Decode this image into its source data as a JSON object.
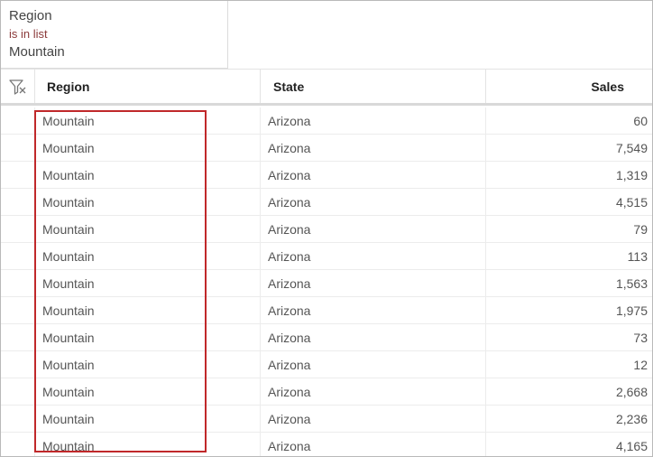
{
  "filter": {
    "field": "Region",
    "operator": "is in list",
    "value": "Mountain"
  },
  "table": {
    "columns": [
      "Region",
      "State",
      "Sales"
    ],
    "rows": [
      [
        "Mountain",
        "Arizona",
        "60"
      ],
      [
        "Mountain",
        "Arizona",
        "7,549"
      ],
      [
        "Mountain",
        "Arizona",
        "1,319"
      ],
      [
        "Mountain",
        "Arizona",
        "4,515"
      ],
      [
        "Mountain",
        "Arizona",
        "79"
      ],
      [
        "Mountain",
        "Arizona",
        "113"
      ],
      [
        "Mountain",
        "Arizona",
        "1,563"
      ],
      [
        "Mountain",
        "Arizona",
        "1,975"
      ],
      [
        "Mountain",
        "Arizona",
        "73"
      ],
      [
        "Mountain",
        "Arizona",
        "12"
      ],
      [
        "Mountain",
        "Arizona",
        "2,668"
      ],
      [
        "Mountain",
        "Arizona",
        "2,236"
      ],
      [
        "Mountain",
        "Arizona",
        "4,165"
      ]
    ]
  },
  "colors": {
    "highlight": "#c0282a",
    "operator_text": "#8b3a3a"
  }
}
